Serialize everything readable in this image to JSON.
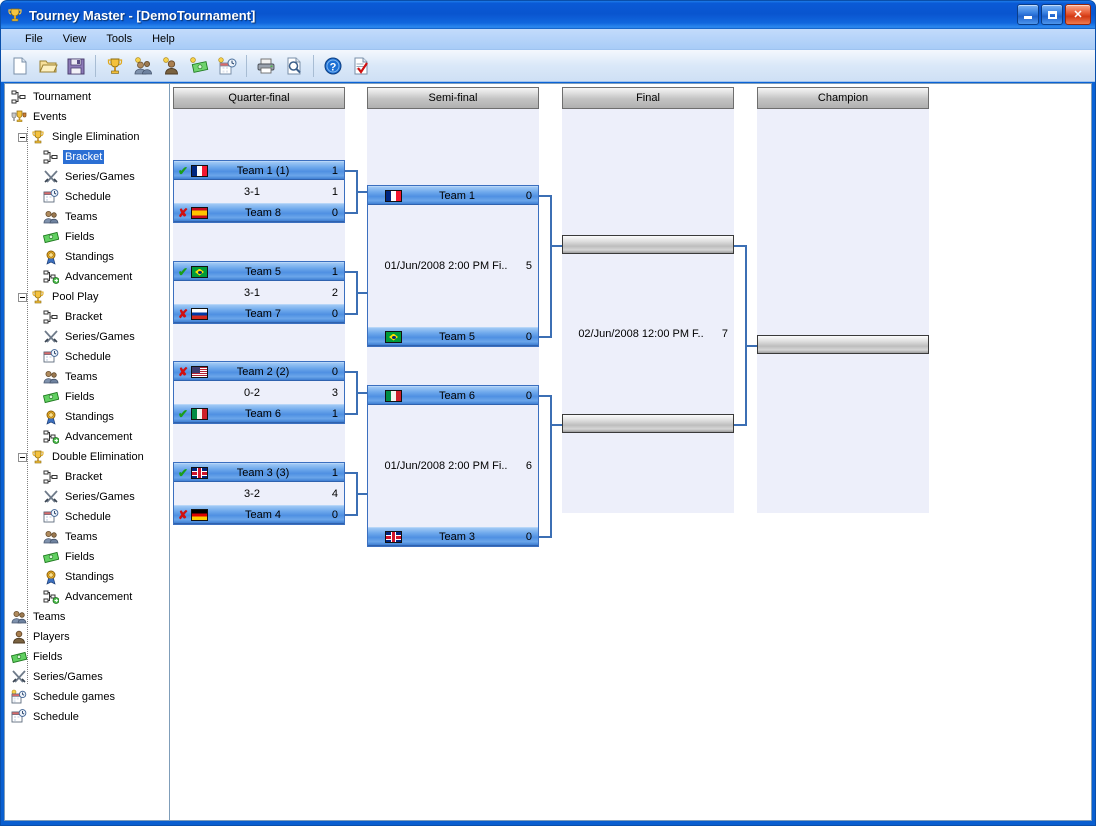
{
  "window": {
    "title": "Tourney Master  - [DemoTournament]",
    "icon": "trophy-icon",
    "minimize_label": "Minimize",
    "maximize_label": "Maximize",
    "close_label": "Close"
  },
  "menubar": {
    "items": [
      {
        "label": "File"
      },
      {
        "label": "View"
      },
      {
        "label": "Tools"
      },
      {
        "label": "Help"
      }
    ]
  },
  "toolbar": {
    "buttons": [
      {
        "name": "new-document-icon",
        "title": "New"
      },
      {
        "name": "open-folder-icon",
        "title": "Open"
      },
      {
        "name": "save-floppy-icon",
        "title": "Save"
      },
      {
        "name": "separator",
        "title": ""
      },
      {
        "name": "new-tournament-trophy-icon",
        "title": "New Tournament"
      },
      {
        "name": "new-teams-icon",
        "title": "New Teams"
      },
      {
        "name": "new-player-icon",
        "title": "New Player"
      },
      {
        "name": "new-field-icon",
        "title": "New Field"
      },
      {
        "name": "schedule-games-icon",
        "title": "Schedule Games"
      },
      {
        "name": "separator",
        "title": ""
      },
      {
        "name": "print-icon",
        "title": "Print"
      },
      {
        "name": "print-preview-icon",
        "title": "Print Preview"
      },
      {
        "name": "separator",
        "title": ""
      },
      {
        "name": "help-icon",
        "title": "Help"
      },
      {
        "name": "check-report-icon",
        "title": "Report"
      }
    ]
  },
  "sidebar": {
    "nodes": [
      {
        "label": "Tournament",
        "level": 0,
        "icon": "bracket-icon",
        "expander": "none",
        "selected": false
      },
      {
        "label": "Events",
        "level": 0,
        "icon": "trophies-icon",
        "expander": "none",
        "selected": false
      },
      {
        "label": "Single Elimination",
        "level": 1,
        "icon": "trophy-icon",
        "expander": "minus",
        "selected": false
      },
      {
        "label": "Bracket",
        "level": 2,
        "icon": "bracket-icon",
        "expander": "none",
        "selected": true
      },
      {
        "label": "Series/Games",
        "level": 2,
        "icon": "crossed-swords-icon",
        "expander": "none",
        "selected": false
      },
      {
        "label": "Schedule",
        "level": 2,
        "icon": "calendar-clock-icon",
        "expander": "none",
        "selected": false
      },
      {
        "label": "Teams",
        "level": 2,
        "icon": "teams-icon",
        "expander": "none",
        "selected": false
      },
      {
        "label": "Fields",
        "level": 2,
        "icon": "field-money-icon",
        "expander": "none",
        "selected": false
      },
      {
        "label": "Standings",
        "level": 2,
        "icon": "medal-icon",
        "expander": "none",
        "selected": false
      },
      {
        "label": "Advancement",
        "level": 2,
        "icon": "advancement-icon",
        "expander": "none",
        "selected": false
      },
      {
        "label": "Pool Play",
        "level": 1,
        "icon": "trophy-icon",
        "expander": "minus",
        "selected": false
      },
      {
        "label": "Bracket",
        "level": 2,
        "icon": "bracket-icon",
        "expander": "none",
        "selected": false
      },
      {
        "label": "Series/Games",
        "level": 2,
        "icon": "crossed-swords-icon",
        "expander": "none",
        "selected": false
      },
      {
        "label": "Schedule",
        "level": 2,
        "icon": "calendar-clock-icon",
        "expander": "none",
        "selected": false
      },
      {
        "label": "Teams",
        "level": 2,
        "icon": "teams-icon",
        "expander": "none",
        "selected": false
      },
      {
        "label": "Fields",
        "level": 2,
        "icon": "field-money-icon",
        "expander": "none",
        "selected": false
      },
      {
        "label": "Standings",
        "level": 2,
        "icon": "medal-icon",
        "expander": "none",
        "selected": false
      },
      {
        "label": "Advancement",
        "level": 2,
        "icon": "advancement-icon",
        "expander": "none",
        "selected": false
      },
      {
        "label": "Double Elimination",
        "level": 1,
        "icon": "trophy-icon",
        "expander": "minus",
        "selected": false
      },
      {
        "label": "Bracket",
        "level": 2,
        "icon": "bracket-icon",
        "expander": "none",
        "selected": false
      },
      {
        "label": "Series/Games",
        "level": 2,
        "icon": "crossed-swords-icon",
        "expander": "none",
        "selected": false
      },
      {
        "label": "Schedule",
        "level": 2,
        "icon": "calendar-clock-icon",
        "expander": "none",
        "selected": false
      },
      {
        "label": "Teams",
        "level": 2,
        "icon": "teams-icon",
        "expander": "none",
        "selected": false
      },
      {
        "label": "Fields",
        "level": 2,
        "icon": "field-money-icon",
        "expander": "none",
        "selected": false
      },
      {
        "label": "Standings",
        "level": 2,
        "icon": "medal-icon",
        "expander": "none",
        "selected": false
      },
      {
        "label": "Advancement",
        "level": 2,
        "icon": "advancement-icon",
        "expander": "none",
        "selected": false
      },
      {
        "label": "Teams",
        "level": 0,
        "icon": "teams-icon",
        "expander": "none",
        "selected": false
      },
      {
        "label": "Players",
        "level": 0,
        "icon": "player-icon",
        "expander": "none",
        "selected": false
      },
      {
        "label": "Fields",
        "level": 0,
        "icon": "field-money-icon",
        "expander": "none",
        "selected": false
      },
      {
        "label": "Series/Games",
        "level": 0,
        "icon": "crossed-swords-icon",
        "expander": "none",
        "selected": false
      },
      {
        "label": "Schedule games",
        "level": 0,
        "icon": "schedule-games-icon",
        "expander": "none",
        "selected": false
      },
      {
        "label": "Schedule",
        "level": 0,
        "icon": "calendar-clock-icon",
        "expander": "none",
        "selected": false
      }
    ]
  },
  "bracket": {
    "rounds": [
      {
        "title": "Quarter-final"
      },
      {
        "title": "Semi-final"
      },
      {
        "title": "Final"
      },
      {
        "title": "Champion"
      }
    ],
    "quarter_final": [
      {
        "top": {
          "mark": "win",
          "mark_glyph": "✔",
          "flag": "f-fr",
          "flag_name": "flag-france",
          "name": "Team 1 (1)",
          "score": "1"
        },
        "info": {
          "text": "3-1",
          "num": "1"
        },
        "bottom": {
          "mark": "lose",
          "mark_glyph": "✘",
          "flag": "f-es",
          "flag_name": "flag-spain",
          "name": "Team 8",
          "score": "0"
        }
      },
      {
        "top": {
          "mark": "win",
          "mark_glyph": "✔",
          "flag": "f-br",
          "flag_name": "flag-brazil",
          "name": "Team 5",
          "score": "1"
        },
        "info": {
          "text": "3-1",
          "num": "2"
        },
        "bottom": {
          "mark": "lose",
          "mark_glyph": "✘",
          "flag": "f-ru",
          "flag_name": "flag-russia",
          "name": "Team 7",
          "score": "0"
        }
      },
      {
        "top": {
          "mark": "lose",
          "mark_glyph": "✘",
          "flag": "f-us",
          "flag_name": "flag-usa",
          "name": "Team 2 (2)",
          "score": "0"
        },
        "info": {
          "text": "0-2",
          "num": "3"
        },
        "bottom": {
          "mark": "win",
          "mark_glyph": "✔",
          "flag": "f-it",
          "flag_name": "flag-italy",
          "name": "Team 6",
          "score": "1"
        }
      },
      {
        "top": {
          "mark": "win",
          "mark_glyph": "✔",
          "flag": "f-gb",
          "flag_name": "flag-uk",
          "name": "Team 3 (3)",
          "score": "1"
        },
        "info": {
          "text": "3-2",
          "num": "4"
        },
        "bottom": {
          "mark": "lose",
          "mark_glyph": "✘",
          "flag": "f-de",
          "flag_name": "flag-germany",
          "name": "Team 4",
          "score": "0"
        }
      }
    ],
    "semi_final": [
      {
        "top": {
          "flag": "f-fr",
          "flag_name": "flag-france",
          "name": "Team 1",
          "score": "0"
        },
        "info": {
          "text": "01/Jun/2008 2:00 PM Fi..",
          "num": "5"
        },
        "bottom": {
          "flag": "f-br",
          "flag_name": "flag-brazil",
          "name": "Team 5",
          "score": "0"
        }
      },
      {
        "top": {
          "flag": "f-it",
          "flag_name": "flag-italy",
          "name": "Team 6",
          "score": "0"
        },
        "info": {
          "text": "01/Jun/2008 2:00 PM Fi..",
          "num": "6"
        },
        "bottom": {
          "flag": "f-gb",
          "flag_name": "flag-uk",
          "name": "Team 3",
          "score": "0"
        }
      }
    ],
    "final": [
      {
        "top": {
          "name": "",
          "score": "",
          "blank": true
        },
        "info": {
          "text": "02/Jun/2008 12:00 PM F..",
          "num": "7"
        },
        "bottom": {
          "name": "",
          "score": "",
          "blank": true
        }
      }
    ],
    "champion": [
      {
        "top": {
          "name": "",
          "score": "",
          "blank": true
        }
      }
    ]
  }
}
